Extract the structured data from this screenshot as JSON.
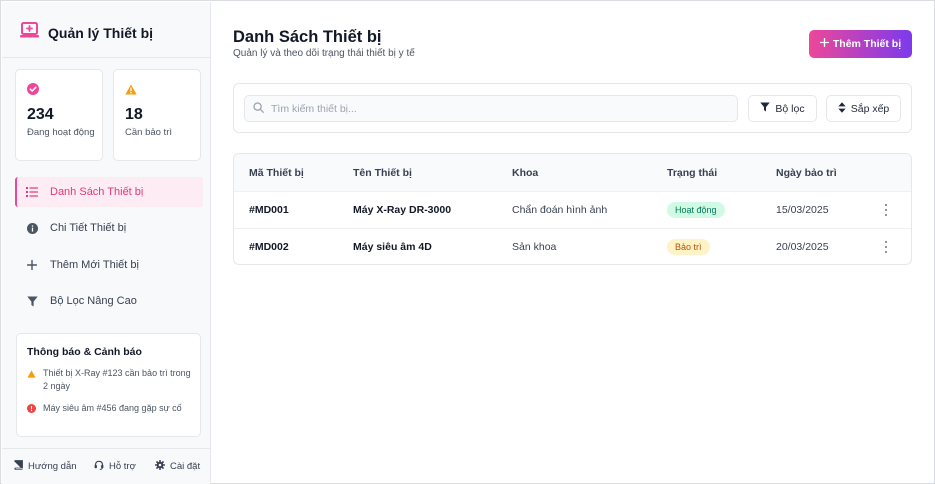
{
  "sidebar": {
    "brand": "Quản lý Thiết bị",
    "brand_icon": "laptop-medical-icon",
    "stats": [
      {
        "value": "234",
        "label": "Đang hoạt động",
        "icon": "check-circle-icon",
        "color": "#ec4899"
      },
      {
        "value": "18",
        "label": "Cần bảo trì",
        "icon": "warning-triangle-icon",
        "color": "#f59e0b"
      }
    ],
    "nav": [
      {
        "label": "Danh Sách Thiết bị",
        "icon": "list-icon",
        "active": true
      },
      {
        "label": "Chi Tiết Thiết bị",
        "icon": "info-circle-icon",
        "active": false
      },
      {
        "label": "Thêm Mới Thiết bị",
        "icon": "plus-icon",
        "active": false
      },
      {
        "label": "Bộ Lọc Nâng Cao",
        "icon": "filter-icon",
        "active": false
      }
    ],
    "notifications": {
      "title": "Thông báo & Cảnh báo",
      "items": [
        {
          "text": "Thiết bị X-Ray #123 cần bảo trì trong 2 ngày",
          "icon": "warning-triangle-icon",
          "color": "#f59e0b"
        },
        {
          "text": "Máy siêu âm #456 đang gặp sự cố",
          "icon": "error-circle-icon",
          "color": "#ef4444"
        }
      ]
    },
    "footer": [
      {
        "label": "Hướng dẫn",
        "icon": "book-icon"
      },
      {
        "label": "Hỗ trợ",
        "icon": "headset-icon"
      },
      {
        "label": "Cài đặt",
        "icon": "gear-icon"
      }
    ]
  },
  "header": {
    "title": "Danh Sách Thiết bị",
    "subtitle": "Quản lý và theo dõi trạng thái thiết bị y tế",
    "add_button": "Thêm Thiết bị"
  },
  "toolbar": {
    "search_placeholder": "Tìm kiếm thiết bị...",
    "filter_label": "Bộ lọc",
    "sort_label": "Sắp xếp"
  },
  "table": {
    "columns": [
      "Mã Thiết bị",
      "Tên Thiết bị",
      "Khoa",
      "Trạng thái",
      "Ngày bảo trì"
    ],
    "rows": [
      {
        "id": "#MD001",
        "name": "Máy X-Ray DR-3000",
        "dept": "Chẩn đoán hình ảnh",
        "status": "Hoạt động",
        "status_type": "ok",
        "date": "15/03/2025"
      },
      {
        "id": "#MD002",
        "name": "Máy siêu âm 4D",
        "dept": "Sản khoa",
        "status": "Bảo trì",
        "status_type": "warn",
        "date": "20/03/2025"
      }
    ]
  },
  "colors": {
    "accent": "#ec4899",
    "accent_gradient_end": "#7c3aed",
    "ok": "#047857",
    "warn": "#b45309"
  }
}
